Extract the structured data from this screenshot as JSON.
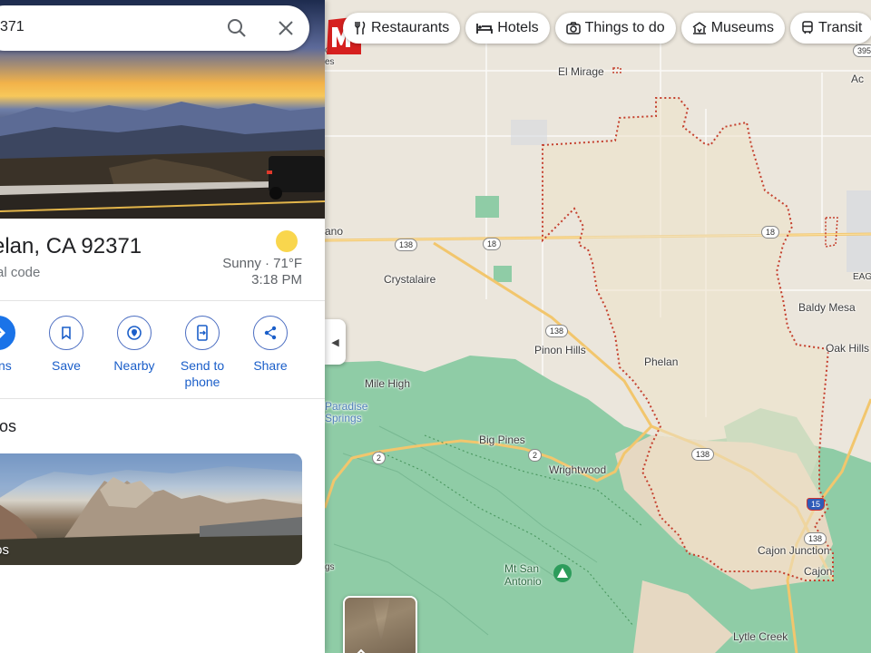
{
  "search": {
    "value": "371"
  },
  "place": {
    "title": "elan, CA 92371",
    "subtitle": "al code",
    "weather_line1": "Sunny · 71°F",
    "weather_line2": "3:18 PM"
  },
  "actions": [
    {
      "label": "tions",
      "label2": ""
    },
    {
      "label": "Save",
      "label2": ""
    },
    {
      "label": "Nearby",
      "label2": ""
    },
    {
      "label": "Send to",
      "label2": "phone"
    },
    {
      "label": "Share",
      "label2": ""
    }
  ],
  "photos": {
    "section_title": "tos",
    "card_label": "tos"
  },
  "chips": [
    {
      "label": "Restaurants",
      "icon": "restaurant-icon"
    },
    {
      "label": "Hotels",
      "icon": "hotel-icon"
    },
    {
      "label": "Things to do",
      "icon": "camera-icon"
    },
    {
      "label": "Museums",
      "icon": "museum-icon"
    },
    {
      "label": "Transit",
      "icon": "transit-icon"
    }
  ],
  "map": {
    "places": {
      "el_mirage": "El Mirage",
      "crystalaire": "Crystalaire",
      "pinon_hills": "Pinon Hills",
      "phelan": "Phelan",
      "baldy_mesa": "Baldy Mesa",
      "oak_hills": "Oak Hills",
      "mile_high": "Mile High",
      "paradise_springs": "Paradise Springs",
      "big_pines": "Big Pines",
      "wrightwood": "Wrightwood",
      "mt_san_antonio": "Mt San Antonio",
      "cajon_junction": "Cajon Junction",
      "cajon": "Cajon",
      "lytle_creek": "Lytle Creek",
      "ano": "ano",
      "os": "os",
      "es": "es",
      "gs": "gs",
      "ag": "EAG",
      "ac": "Ac"
    },
    "routes": {
      "r138a": "138",
      "r18a": "18",
      "r18b": "18",
      "r138b": "138",
      "r138c": "138",
      "r2a": "2",
      "r2b": "2",
      "i15": "15",
      "r395": "395",
      "r138d": "138"
    }
  },
  "colors": {
    "land": "#ebe6dc",
    "forest": "#8fcca6",
    "boundary": "#c5412f",
    "highway": "#f2c66d",
    "accent": "#1a73e8"
  }
}
